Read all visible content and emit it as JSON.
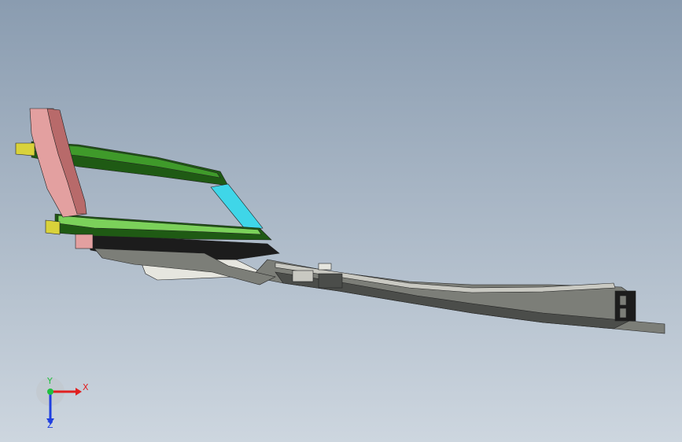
{
  "viewport": {
    "background_top": "#8a9cb0",
    "background_bottom": "#cdd6df"
  },
  "model": {
    "colors": {
      "green_dark": "#1f5a14",
      "green": "#3f9a2a",
      "green_light": "#7bd15a",
      "cyan": "#3fd6e8",
      "pink": "#e3a0a0",
      "pink_dark": "#b86a6a",
      "yellow": "#d9d23a",
      "gray_dark": "#4b4d4a",
      "gray": "#7c7e78",
      "gray_light": "#c9c9c2",
      "white_part": "#e6e6df",
      "black": "#1c1c1c"
    }
  },
  "triad": {
    "x_label": "X",
    "y_label": "Y",
    "z_label": "Z",
    "x_color": "#e02020",
    "y_color": "#20c040",
    "z_color": "#2040e0"
  }
}
